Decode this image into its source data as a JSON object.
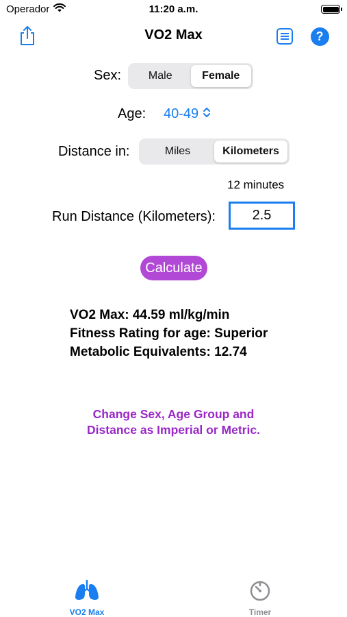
{
  "status_bar": {
    "carrier": "Operador",
    "time": "11:20 a.m."
  },
  "nav": {
    "title": "VO2 Max",
    "left_icon": "share-icon",
    "right_icons": [
      "list-icon",
      "help-icon"
    ],
    "help_glyph": "?"
  },
  "form": {
    "sex": {
      "label": "Sex:",
      "options": [
        "Male",
        "Female"
      ],
      "selected": "Female"
    },
    "age": {
      "label": "Age:",
      "value": "40-49",
      "icon": "chevron-up-down-icon"
    },
    "distance_unit": {
      "label": "Distance in:",
      "options": [
        "Miles",
        "Kilometers"
      ],
      "selected": "Kilometers"
    },
    "duration": "12 minutes",
    "run_distance": {
      "label": "Run Distance (Kilometers):",
      "value": "2.5"
    },
    "calculate_label": "Calculate"
  },
  "results": {
    "vo2": "VO2 Max: 44.59 ml/kg/min",
    "rating": "Fitness Rating for age: Superior",
    "mets": "Metabolic Equivalents: 12.74"
  },
  "hint": {
    "line1": "Change Sex, Age Group and",
    "line2": "Distance as Imperial or Metric."
  },
  "tab_bar": {
    "tabs": [
      {
        "label": "VO2 Max",
        "icon": "lungs-icon",
        "active": true
      },
      {
        "label": "Timer",
        "icon": "timer-icon",
        "active": false
      }
    ]
  },
  "colors": {
    "accent_blue": "#1a7ef0",
    "purple": "#b248d6",
    "hint_purple": "#9a27c7",
    "inactive_gray": "#8e8e93"
  }
}
